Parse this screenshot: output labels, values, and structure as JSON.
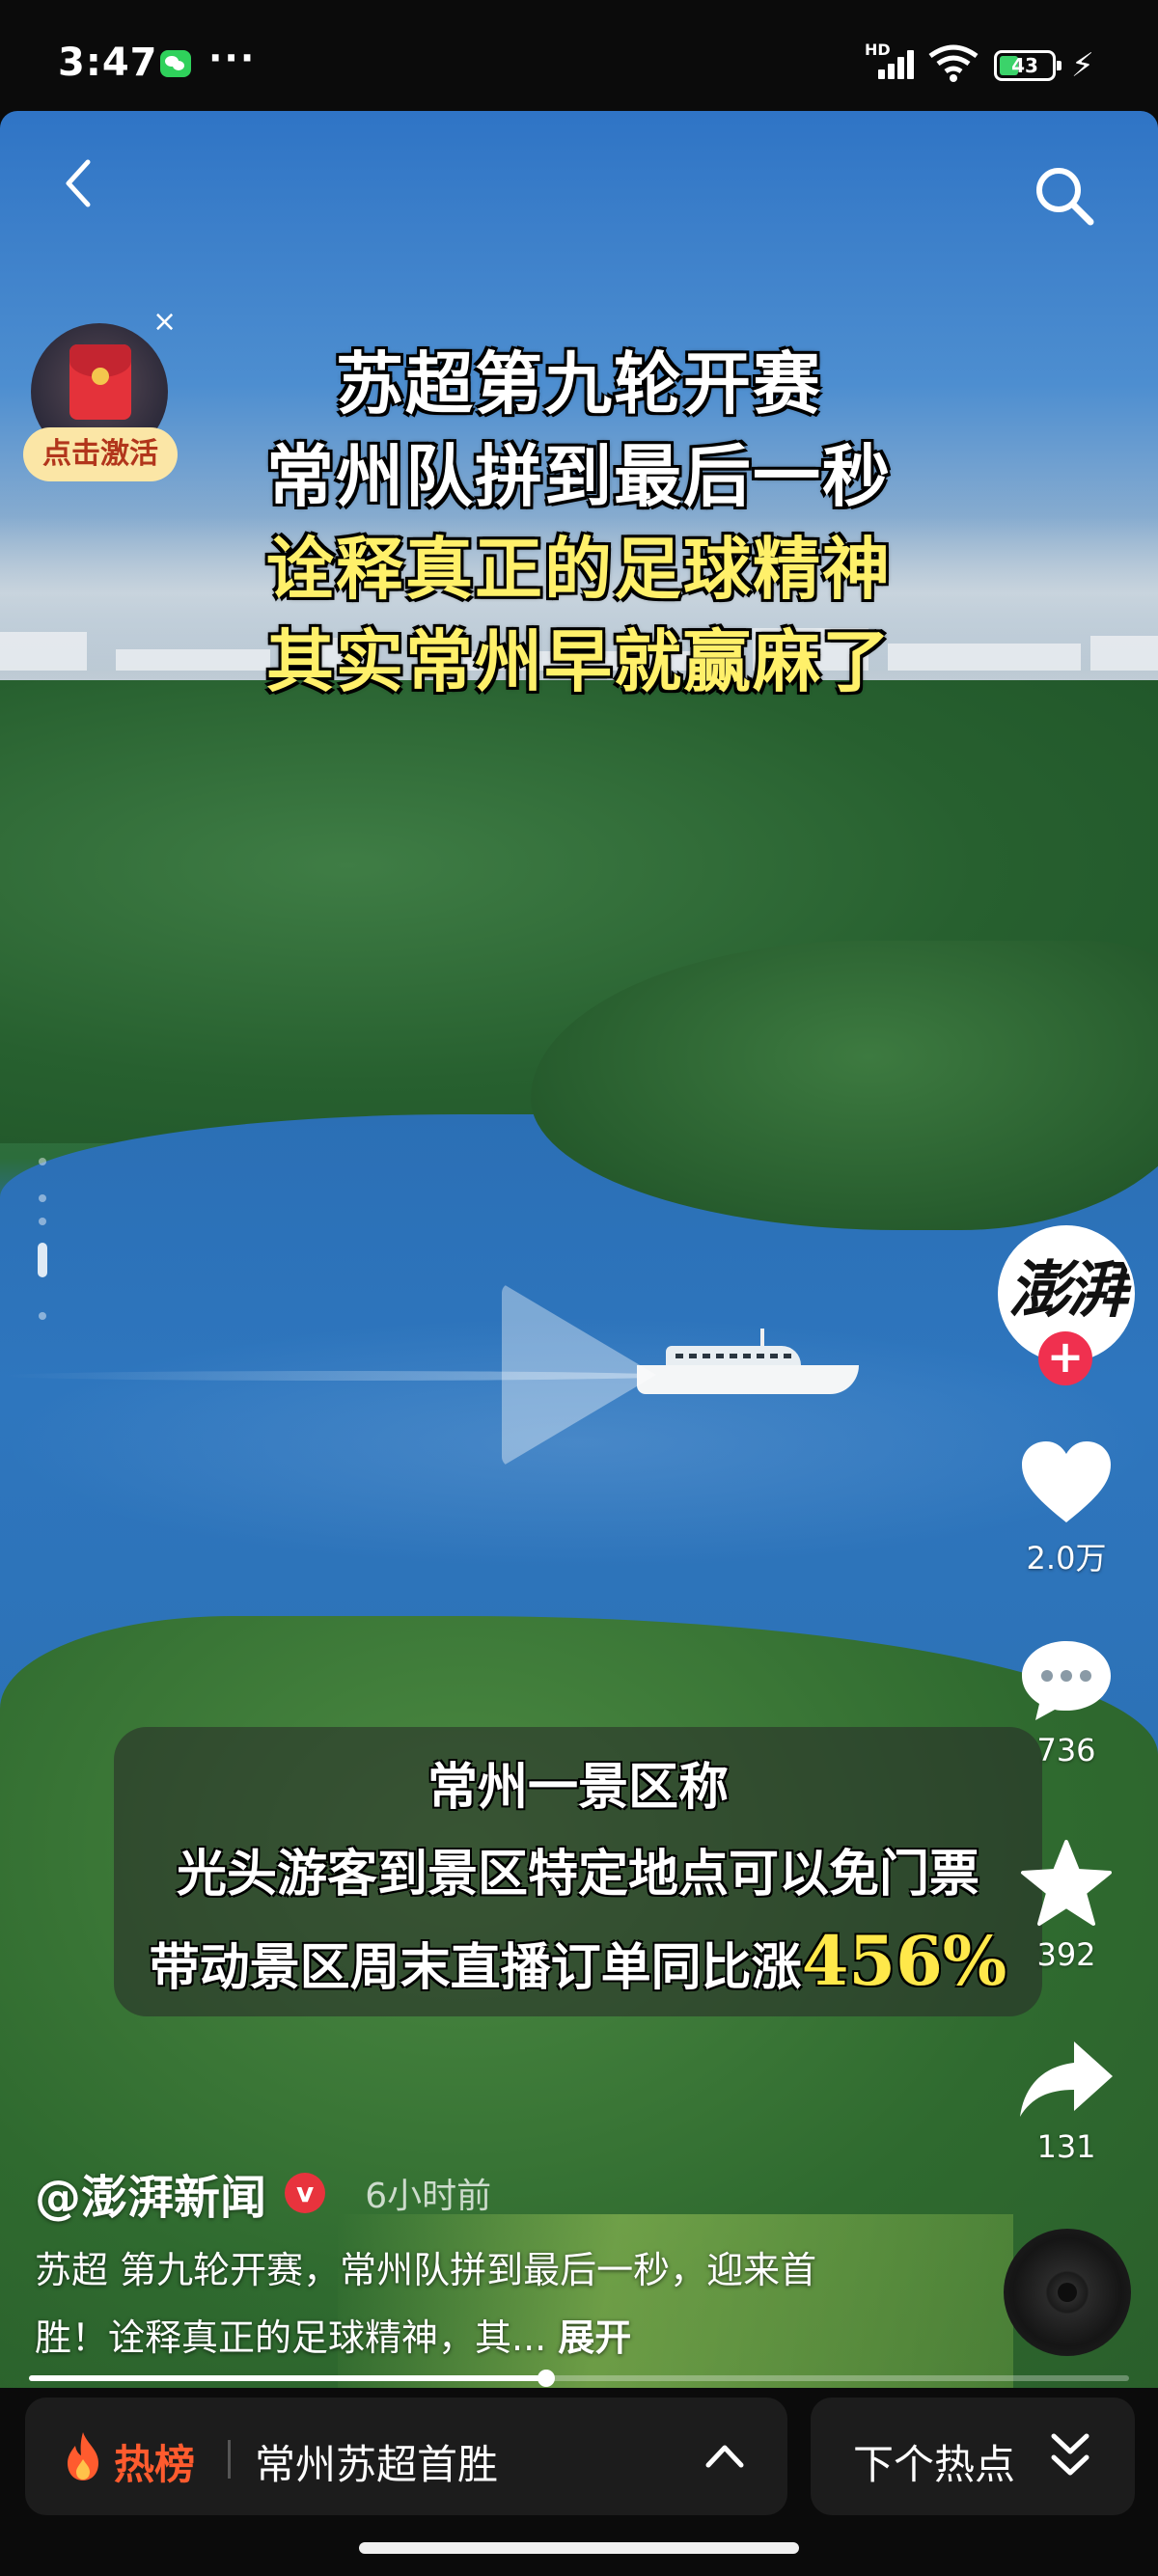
{
  "status_bar": {
    "time": "3:47",
    "more": "···",
    "network": "HD",
    "battery": "43",
    "battery_level": 0.43
  },
  "video": {
    "title_lines": [
      "苏超第九轮开赛",
      "常州队拼到最后一秒",
      "诠释真正的足球精神",
      "其实常州早就赢麻了"
    ],
    "title_colors": [
      "#ffffff",
      "#ffffff",
      "#fff06a",
      "#fff06a"
    ],
    "caption_line1": "常州一景区称",
    "caption_line2": "光头游客到景区特定地点可以免门票",
    "caption_line3_text": "带动景区周末直播订单同比涨",
    "caption_line3_pct": "456%",
    "progress": 0.47
  },
  "promo": {
    "label": "点击激活",
    "close": "×"
  },
  "account": {
    "avatar_text": "澎湃",
    "follow": "+",
    "name": "@澎湃新闻",
    "verified_mark": "v",
    "time_ago": "6小时前"
  },
  "actions": {
    "likes": "2.0万",
    "comments": "736",
    "favorites": "392",
    "shares": "131"
  },
  "description": {
    "text": "苏超 第九轮开赛，常州队拼到最后一秒，迎来首胜！诠释真正的足球精神，其...",
    "expand": "展开"
  },
  "bottom_bar": {
    "hot_label": "热榜",
    "hot_topic": "常州苏超首胜",
    "next_label": "下个热点"
  },
  "icons": {
    "back": "chevron-left-icon",
    "search": "search-icon",
    "like": "heart-icon",
    "comment": "comment-icon",
    "favorite": "star-icon",
    "share": "share-icon",
    "play": "play-icon",
    "fire": "fire-icon"
  },
  "colors": {
    "accent_red": "#f0304f",
    "hot_orange": "#ff5b2e",
    "highlight_yellow": "#fff06a"
  }
}
